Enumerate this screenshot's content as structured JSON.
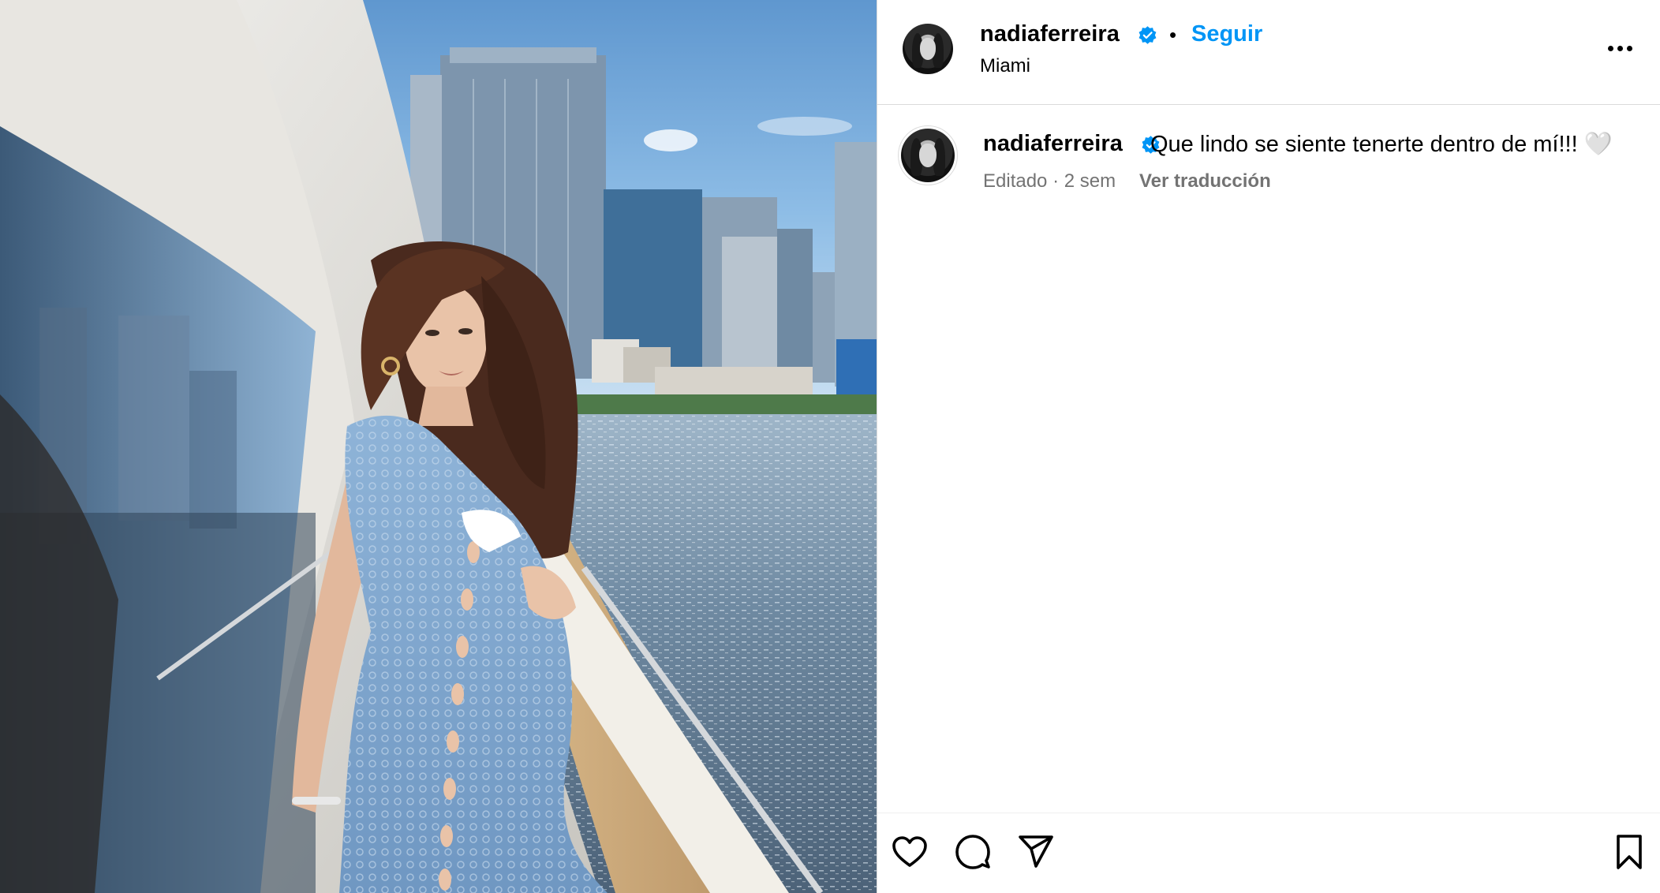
{
  "post": {
    "author": {
      "username": "nadiaferreira",
      "verified": true,
      "location": "Miami",
      "follow_label": "Seguir",
      "separator": "•"
    },
    "caption": {
      "username": "nadiaferreira",
      "text": "Que lindo se siente tenerte dentro de mí!!! 🤍",
      "meta": "Editado · 2 sem",
      "translate_label": "Ver traducción"
    },
    "actions": {
      "icons": [
        "heart-icon",
        "comment-icon",
        "share-icon",
        "bookmark-icon"
      ]
    },
    "photo": {
      "subject": "woman in blue crochet dress on yacht, Miami skyline"
    },
    "colors": {
      "link_blue": "#0095f6",
      "verified_blue": "#0095f6",
      "muted_text": "#737373",
      "divider": "#dbdbdb"
    },
    "more_options_icon": "more-horizontal-icon"
  }
}
